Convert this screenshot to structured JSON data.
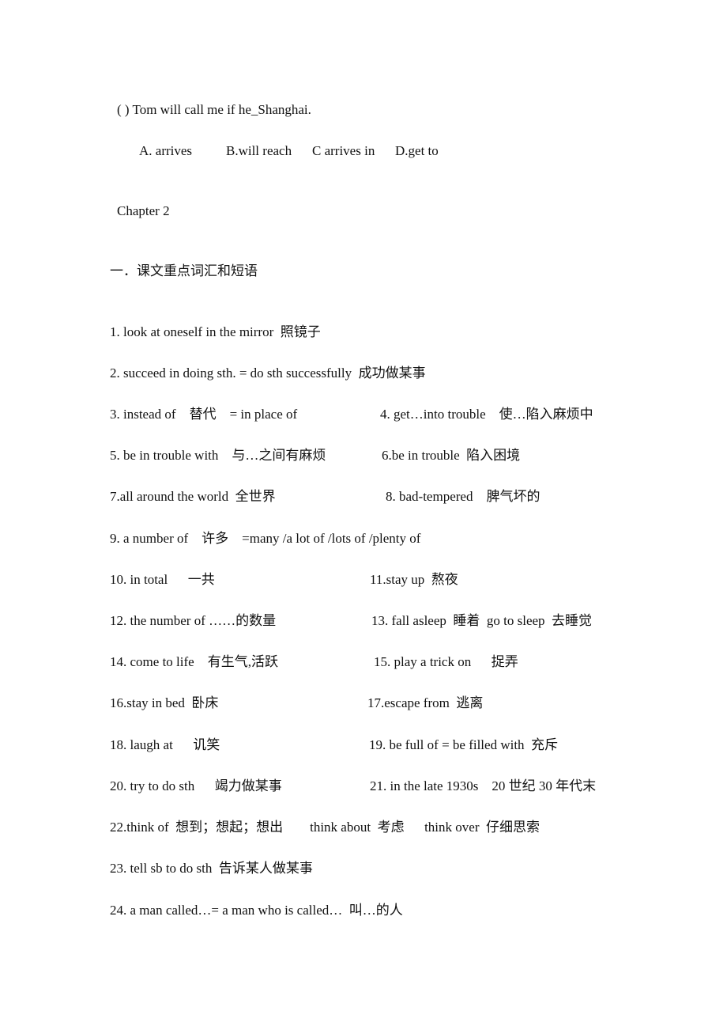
{
  "question": {
    "stem": "( ) Tom will call me if he_Shanghai.",
    "options": [
      "A. arrives",
      "B.will reach",
      "C arrives in",
      "D.get to"
    ]
  },
  "chapter_title": "Chapter 2",
  "section_heading": "一．课文重点词汇和短语",
  "items": [
    {
      "left": "1. look at oneself in the mirror  照镜子"
    },
    {
      "left": "2. succeed in doing sth. = do sth successfully  成功做某事"
    },
    {
      "left": "3. instead of    替代    = in place of",
      "right": "4. get…into trouble    使…陷入麻烦中"
    },
    {
      "left": "5. be in trouble with    与…之间有麻烦",
      "right": "6.be in trouble  陷入困境"
    },
    {
      "left": "7.all around the world  全世界",
      "right": "8. bad-tempered    脾气坏的"
    },
    {
      "left": "9. a number of    许多    =many /a lot of /lots of /plenty of"
    },
    {
      "left": "10. in total      一共",
      "right": "11.stay up  熬夜"
    },
    {
      "left": "12. the number of ……的数量",
      "right": "13. fall asleep  睡着  go to sleep  去睡觉"
    },
    {
      "left": "14. come to life    有生气,活跃",
      "right": "15. play a trick on      捉弄"
    },
    {
      "left": "16.stay in bed  卧床",
      "right": "17.escape from  逃离"
    },
    {
      "left": "18. laugh at      讥笑",
      "right": "19. be full of = be filled with  充斥"
    },
    {
      "left": "20. try to do sth      竭力做某事",
      "right": "21. in the late 1930s    20 世纪 30 年代末"
    },
    {
      "left": "22.think of  想到；想起；想出        think about  考虑      think over  仔细思索"
    },
    {
      "left": "23. tell sb to do sth  告诉某人做某事"
    },
    {
      "left": "24. a man called…= a man who is called…  叫…的人"
    }
  ]
}
